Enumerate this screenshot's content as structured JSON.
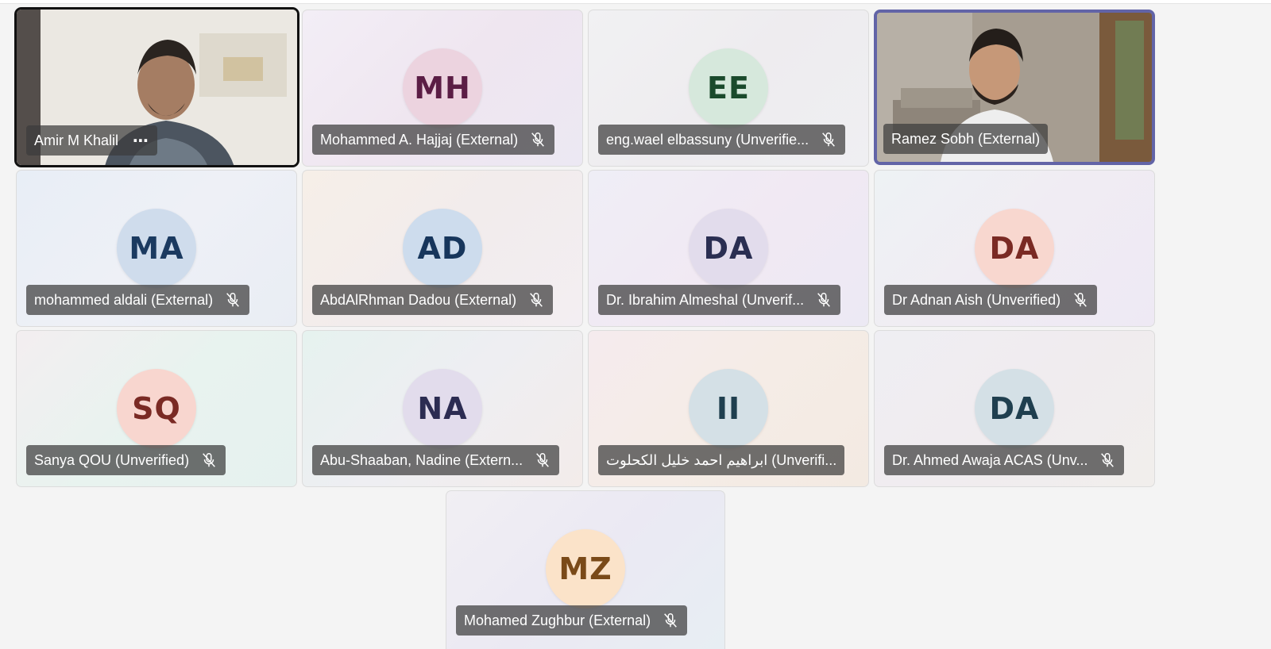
{
  "participants": [
    {
      "name": "Amir M Khalil",
      "type": "video",
      "more": "⋯"
    },
    {
      "name": "Mohammed A. Hajjaj (External)",
      "initials": "MH",
      "avatar_bg": "#ecd3df",
      "avatar_fg": "#5b1d45",
      "muted": true
    },
    {
      "name": "eng.wael elbassuny (Unverifie...",
      "initials": "EE",
      "avatar_bg": "#d6e8dc",
      "avatar_fg": "#1a4a2c",
      "muted": true
    },
    {
      "name": "Ramez Sobh (External)",
      "type": "video",
      "speaking": true
    },
    {
      "name": "mohammed aldali (External)",
      "initials": "MA",
      "avatar_bg": "#cfdcec",
      "avatar_fg": "#1b3a60",
      "muted": true
    },
    {
      "name": "AbdAlRhman Dadou (External)",
      "initials": "AD",
      "avatar_bg": "#cddced",
      "avatar_fg": "#17365c",
      "muted": true
    },
    {
      "name": "Dr. Ibrahim Almeshal (Unverif...",
      "initials": "DA",
      "avatar_bg": "#e2dcec",
      "avatar_fg": "#2a2e52",
      "muted": true
    },
    {
      "name": "Dr Adnan Aish (Unverified)",
      "initials": "DA",
      "avatar_bg": "#f8d7cf",
      "avatar_fg": "#7a2a24",
      "muted": true
    },
    {
      "name": "Sanya QOU (Unverified)",
      "initials": "SQ",
      "avatar_bg": "#f8d6cf",
      "avatar_fg": "#7a2a24",
      "muted": true
    },
    {
      "name": "Abu-Shaaban, Nadine (Extern...",
      "initials": "NA",
      "avatar_bg": "#e2dcec",
      "avatar_fg": "#2c2c52",
      "muted": true
    },
    {
      "name": "ابراهيم احمد خليل الكحلوت (Unverifi...",
      "initials": "II",
      "avatar_bg": "#d4e0e6",
      "avatar_fg": "#1f3f4f",
      "muted": true
    },
    {
      "name": "Dr. Ahmed Awaja ACAS (Unv...",
      "initials": "DA",
      "avatar_bg": "#d4e0e6",
      "avatar_fg": "#1f3f4f",
      "muted": true
    },
    {
      "name": "Mohamed Zughbur (External)",
      "initials": "MZ",
      "avatar_bg": "#fbe3c9",
      "avatar_fg": "#7a4a18",
      "muted": true
    }
  ],
  "colors": {
    "speaking_border": "#6264a7",
    "nameplate_bg": "rgba(60,60,60,0.72)"
  }
}
